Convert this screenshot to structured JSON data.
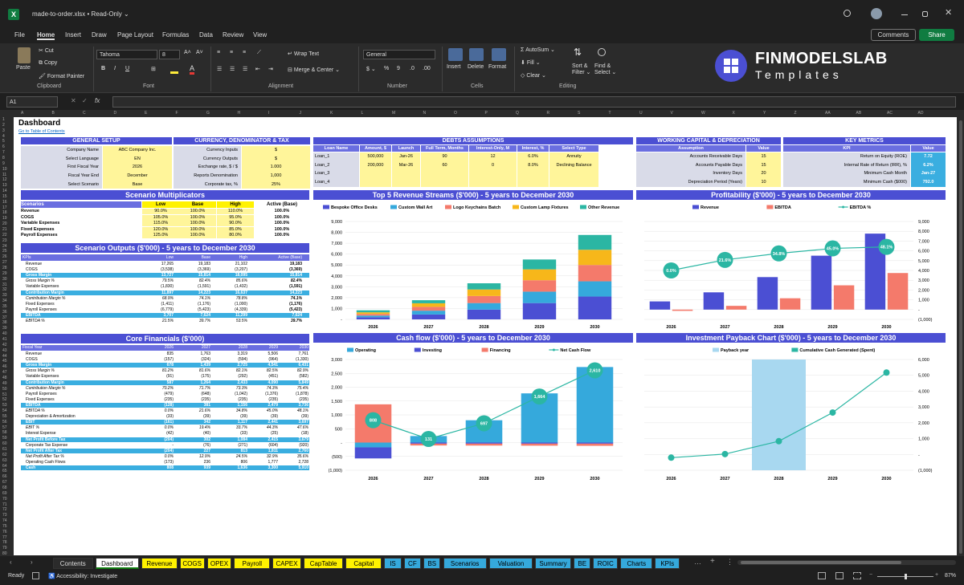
{
  "titlebar": {
    "file": "made-to-order.xlsx",
    "sep": "•",
    "mode": "Read-Only",
    "chev": "⌄"
  },
  "menu": [
    "File",
    "Home",
    "Insert",
    "Draw",
    "Page Layout",
    "Formulas",
    "Data",
    "Review",
    "View"
  ],
  "comments_label": "Comments",
  "share_label": "Share",
  "ribbon": {
    "paste": "Paste",
    "cut": "Cut",
    "copy": "Copy",
    "format_painter": "Format Painter",
    "clipboard": "Clipboard",
    "font_name": "Tahoma",
    "font_size": "8",
    "font_group": "Font",
    "wrap": "Wrap Text",
    "merge": "Merge & Center",
    "alignment": "Alignment",
    "num_format": "General",
    "number": "Number",
    "insert": "Insert",
    "delete": "Delete",
    "format": "Format",
    "cells": "Cells",
    "autosum": "AutoSum",
    "fill": "Fill",
    "clear": "Clear",
    "sort": "Sort &",
    "filter": "Filter",
    "find": "Find &",
    "select": "Select",
    "editing": "Editing",
    "logo_title": "FINMODELSLAB",
    "logo_sub": "Templates"
  },
  "formula": {
    "cellref": "A1",
    "fx": "fx"
  },
  "columns": [
    "A",
    "B",
    "C",
    "D",
    "E",
    "F",
    "G",
    "H",
    "I",
    "J",
    "K",
    "L",
    "M",
    "N",
    "O",
    "P",
    "Q",
    "R",
    "S",
    "T",
    "U",
    "V",
    "W",
    "X",
    "Y",
    "Z",
    "AA",
    "AB",
    "AC",
    "AD"
  ],
  "sheet": {
    "title": "Dashboard",
    "toc": "Go to Table of Contents",
    "general": {
      "header": "GENERAL SETUP",
      "rows": [
        [
          "Company Name",
          "ABC Company Inc."
        ],
        [
          "Select Language",
          "EN"
        ],
        [
          "First Fiscal Year",
          "2026"
        ],
        [
          "Fiscal Year End",
          "December"
        ],
        [
          "Select Scenario",
          "Base"
        ]
      ]
    },
    "currency": {
      "header": "CURRENCY, DENOMINATOR & TAX",
      "rows": [
        [
          "Currency Inputs",
          "$"
        ],
        [
          "Currency Outputs",
          "$"
        ],
        [
          "Exchange rate, $ / $",
          "1.000"
        ],
        [
          "Reports Denomination",
          "1,000"
        ],
        [
          "Corporate tax, %",
          "25%"
        ]
      ]
    },
    "debts": {
      "header": "DEBTS ASSUMPTIONS",
      "cols": [
        "Loan Name",
        "Amount, $",
        "Launch",
        "Full Term, Months",
        "Interest-Only, M",
        "Interest, %",
        "Select Type"
      ],
      "rows": [
        [
          "Loan_1",
          "500,000",
          "Jan-26",
          "90",
          "12",
          "6.0%",
          "Annuity"
        ],
        [
          "Loan_2",
          "200,000",
          "Mar-26",
          "60",
          "0",
          "8.0%",
          "Declining Balance"
        ],
        [
          "Loan_3",
          "",
          "",
          "",
          "",
          "",
          ""
        ],
        [
          "Loan_4",
          "",
          "",
          "",
          "",
          "",
          ""
        ]
      ]
    },
    "wc": {
      "header": "WORKING CAPITAL & DEPRECIATION",
      "cols": [
        "Assumption",
        "Value"
      ],
      "rows": [
        [
          "Accounts Receivable Days",
          "15"
        ],
        [
          "Accounts Payable Days",
          "15"
        ],
        [
          "Inventory Days",
          "20"
        ],
        [
          "Depreciation Period (Years)",
          "10"
        ]
      ]
    },
    "kpi": {
      "header": "KEY METRICS",
      "cols": [
        "KPI",
        "Value"
      ],
      "rows": [
        [
          "Return on Equity (ROE)",
          "7.72"
        ],
        [
          "Internal Rate of Return (IRR), %",
          "6.2%"
        ],
        [
          "Minimum Cash Month",
          "Jan-27"
        ],
        [
          "Minimum Cash ($000)",
          "792.0"
        ]
      ]
    },
    "scen_mult": {
      "header": "Scenario Multiplicators",
      "cols": [
        "Scenarios",
        "Low",
        "Base",
        "High",
        "Active (Base)"
      ],
      "rows": [
        [
          "Revenue",
          "90.0%",
          "100.0%",
          "110.0%",
          "100.0%"
        ],
        [
          "COGS",
          "105.0%",
          "100.0%",
          "95.0%",
          "100.0%"
        ],
        [
          "Variable Expenses",
          "115.0%",
          "100.0%",
          "90.0%",
          "100.0%"
        ],
        [
          "Fixed Expenses",
          "120.0%",
          "100.0%",
          "85.0%",
          "100.0%"
        ],
        [
          "Payroll Expenses",
          "125.0%",
          "100.0%",
          "80.0%",
          "100.0%"
        ]
      ]
    },
    "scen_out": {
      "header": "Scenario Outputs ($'000) - 5 years to December 2030",
      "cols": [
        "KPIs",
        "Low",
        "Base",
        "High",
        "Active (Base)"
      ],
      "rows": [
        {
          "n": "Revenue",
          "v": [
            "17,265",
            "19,183",
            "21,102",
            "19,183"
          ]
        },
        {
          "n": "COGS",
          "v": [
            "(3,538)",
            "(3,369)",
            "(3,207)",
            "(3,369)"
          ]
        },
        {
          "n": "Gross Margin",
          "v": [
            "13,727",
            "15,814",
            "18,095",
            "15,814"
          ],
          "c": "hl"
        },
        {
          "n": "Gross Margin %",
          "v": [
            "79.5%",
            "82.4%",
            "85.6%",
            "82.4%"
          ],
          "c": "it"
        },
        {
          "n": "Variable Expenses",
          "v": [
            "(1,830)",
            "(1,591)",
            "(1,432)",
            "(1,591)"
          ]
        },
        {
          "n": "Contribution Margin",
          "v": [
            "11,897",
            "14,223",
            "16,637",
            "14,223"
          ],
          "c": "hl"
        },
        {
          "n": "Contribution Margin %",
          "v": [
            "68.9%",
            "74.1%",
            "78.8%",
            "74.1%"
          ],
          "c": "it"
        },
        {
          "n": "Fixed Expenses",
          "v": [
            "(1,411)",
            "(1,176)",
            "(1,000)",
            "(1,176)"
          ]
        },
        {
          "n": "Payroll Expenses",
          "v": [
            "(6,779)",
            "(5,423)",
            "(4,339)",
            "(5,423)"
          ]
        },
        {
          "n": "EBITDA",
          "v": [
            "3,707",
            "7,624",
            "11,299",
            "7,624"
          ],
          "c": "hl"
        },
        {
          "n": "EBITDA %",
          "v": [
            "21.5%",
            "39.7%",
            "53.5%",
            "39.7%"
          ],
          "c": "it"
        }
      ]
    },
    "core": {
      "header": "Core Financials ($'000)",
      "cols": [
        "Fiscal Year",
        "2026",
        "2027",
        "2028",
        "2029",
        "2030"
      ],
      "rows": [
        {
          "n": "Revenue",
          "v": [
            "835",
            "1,763",
            "3,319",
            "5,506",
            "7,761"
          ]
        },
        {
          "n": "COGS",
          "v": [
            "(157)",
            "(324)",
            "(594)",
            "(964)",
            "(1,330)"
          ]
        },
        {
          "n": "Gross Margin",
          "v": [
            "678",
            "1,439",
            "2,725",
            "4,541",
            "6,431"
          ],
          "c": "hl"
        },
        {
          "n": "Gross Margin %",
          "v": [
            "81.2%",
            "81.6%",
            "82.1%",
            "82.5%",
            "82.9%"
          ],
          "c": "it"
        },
        {
          "n": "Variable Expenses",
          "v": [
            "(91)",
            "(175)",
            "(292)",
            "(451)",
            "(582)"
          ]
        },
        {
          "n": "Contribution Margin",
          "v": [
            "587",
            "1,264",
            "2,433",
            "4,090",
            "5,849"
          ],
          "c": "hl"
        },
        {
          "n": "Contribution Margin %",
          "v": [
            "70.2%",
            "71.7%",
            "73.3%",
            "74.3%",
            "75.4%"
          ],
          "c": "it"
        },
        {
          "n": "Payroll Expenses",
          "v": [
            "(479)",
            "(648)",
            "(1,042)",
            "(1,376)",
            "(1,878)"
          ]
        },
        {
          "n": "Fixed Expenses",
          "v": [
            "(235)",
            "(235)",
            "(235)",
            "(235)",
            "(235)"
          ]
        },
        {
          "n": "EBITDA",
          "v": [
            "(128)",
            "381",
            "1,156",
            "2,479",
            "3,736"
          ],
          "c": "hl"
        },
        {
          "n": "EBITDA %",
          "v": [
            "0.0%",
            "21.6%",
            "34.8%",
            "45.0%",
            "48.1%"
          ],
          "c": "it"
        },
        {
          "n": "Depreciation & Amortization",
          "v": [
            "(33)",
            "(39)",
            "(39)",
            "(39)",
            "(39)"
          ]
        },
        {
          "n": "EBIT",
          "v": [
            "(161)",
            "342",
            "1,117",
            "2,441",
            "3,697"
          ],
          "c": "hl"
        },
        {
          "n": "EBIT %",
          "v": [
            "0.0%",
            "19.4%",
            "33.7%",
            "44.3%",
            "47.6%"
          ],
          "c": "it"
        },
        {
          "n": "Interest Expense",
          "v": [
            "(42)",
            "(40)",
            "(33)",
            "(25)",
            "(18)"
          ]
        },
        {
          "n": "Net Profit Before Tax",
          "v": [
            "(204)",
            "302",
            "1,084",
            "2,415",
            "3,679"
          ],
          "c": "hl"
        },
        {
          "n": "Corporate Tax Expense",
          "v": [
            "-",
            "(76)",
            "(271)",
            "(604)",
            "(920)"
          ]
        },
        {
          "n": "Net Profit After Tax",
          "v": [
            "(204)",
            "227",
            "813",
            "1,811",
            "2,760"
          ],
          "c": "hl"
        },
        {
          "n": "Net Profit After Tax %",
          "v": [
            "0.0%",
            "12.9%",
            "24.5%",
            "32.9%",
            "35.6%"
          ],
          "c": "it"
        },
        {
          "n": "Operating Cash Flows",
          "v": [
            "(173)",
            "236",
            "806",
            "1,777",
            "2,728"
          ]
        },
        {
          "n": "Cash",
          "v": [
            "808",
            "939",
            "1,636",
            "3,300",
            "5,910"
          ],
          "c": "hl"
        }
      ]
    },
    "chart_titles": {
      "rev": "Top 5 Revenue Streams ($'000) - 5 years to December 2030",
      "prof": "Profitability ($'000) - 5 years to December 2030",
      "cash": "Cash flow ($'000) - 5 years to December 2030",
      "pay": "Investment Payback Chart ($'000) - 5 years to December 2030"
    }
  },
  "chart_data": [
    {
      "type": "bar",
      "stacked": true,
      "title": "Top 5 Revenue Streams ($'000) - 5 years to December 2030",
      "categories": [
        "2026",
        "2027",
        "2028",
        "2029",
        "2030"
      ],
      "ylim": [
        0,
        9000
      ],
      "series": [
        {
          "name": "Bespoke Office Desks",
          "color": "#4b4fd3",
          "values": [
            200,
            450,
            900,
            1500,
            2100
          ]
        },
        {
          "name": "Custom Wall Art",
          "color": "#35a9dc",
          "values": [
            150,
            350,
            600,
            1050,
            1400
          ]
        },
        {
          "name": "Logo Keychains Batch",
          "color": "#f47a6b",
          "values": [
            150,
            350,
            650,
            1050,
            1500
          ]
        },
        {
          "name": "Custom Lamp Fixtures",
          "color": "#f7b71a",
          "values": [
            150,
            330,
            600,
            1000,
            1400
          ]
        },
        {
          "name": "Other Revenue",
          "color": "#2bb6a3",
          "values": [
            185,
            283,
            569,
            906,
            1361
          ]
        }
      ]
    },
    {
      "type": "bar",
      "title": "Profitability ($'000) - 5 years to December 2030",
      "categories": [
        "2026",
        "2027",
        "2028",
        "2029",
        "2030"
      ],
      "ylim": [
        -1000,
        9000
      ],
      "y2lim": [
        -100,
        100
      ],
      "series": [
        {
          "name": "Revenue",
          "color": "#4b4fd3",
          "values": [
            835,
            1763,
            3319,
            5506,
            7761
          ]
        },
        {
          "name": "EBITDA",
          "color": "#f47a6b",
          "values": [
            -128,
            381,
            1156,
            2479,
            3736
          ]
        },
        {
          "name": "EBITDA %",
          "type": "line",
          "color": "#2bb6a3",
          "values": [
            0.0,
            21.6,
            34.8,
            45.0,
            48.1
          ],
          "labels": [
            "0.0%",
            "21.6%",
            "34.8%",
            "45.0%",
            "48.1%"
          ]
        }
      ]
    },
    {
      "type": "bar",
      "stacked": true,
      "title": "Cash flow ($'000) - 5 years to December 2030",
      "categories": [
        "2026",
        "2027",
        "2028",
        "2029",
        "2030"
      ],
      "ylim": [
        -1000,
        3000
      ],
      "series": [
        {
          "name": "Operating",
          "color": "#35a9dc",
          "values": [
            -173,
            236,
            806,
            1777,
            2728
          ]
        },
        {
          "name": "Investing",
          "color": "#4b4fd3",
          "values": [
            -400,
            -40,
            -40,
            -40,
            -40
          ]
        },
        {
          "name": "Financing",
          "color": "#f47a6b",
          "values": [
            1381,
            -65,
            -69,
            -73,
            -78
          ]
        },
        {
          "name": "Net Cash Flow",
          "type": "line",
          "color": "#2bb6a3",
          "values": [
            808,
            131,
            697,
            1664,
            2610
          ],
          "labels": [
            "808",
            "131",
            "697",
            "1,664",
            "2,610"
          ]
        }
      ]
    },
    {
      "type": "line",
      "title": "Investment Payback Chart ($'000) - 5 years to December 2030",
      "categories": [
        "2026",
        "2027",
        "2028",
        "2029",
        "2030"
      ],
      "ylim": [
        -1000,
        6000
      ],
      "series": [
        {
          "name": "Payback year",
          "type": "bar",
          "color": "#a8d8f0",
          "values": [
            0,
            0,
            1,
            0,
            0
          ]
        },
        {
          "name": "Cumulative Cash Generated (Spent)",
          "color": "#2bb6a3",
          "values": [
            -204,
            23,
            836,
            2647,
            5175
          ]
        }
      ]
    }
  ],
  "sheet_tabs": [
    {
      "l": "Contents",
      "c": "t-w"
    },
    {
      "l": "Dashboard",
      "c": "t-a"
    },
    {
      "l": "Revenue",
      "c": "t-y"
    },
    {
      "l": "COGS",
      "c": "t-y"
    },
    {
      "l": "OPEX",
      "c": "t-y"
    },
    {
      "l": "Payroll",
      "c": "t-y"
    },
    {
      "l": "CAPEX",
      "c": "t-y"
    },
    {
      "l": "CapTable",
      "c": "t-y"
    },
    {
      "l": "Capital",
      "c": "t-y"
    },
    {
      "l": "IS",
      "c": "t-b"
    },
    {
      "l": "CF",
      "c": "t-b"
    },
    {
      "l": "BS",
      "c": "t-b"
    },
    {
      "l": "Scenarios",
      "c": "t-b"
    },
    {
      "l": "Valuation",
      "c": "t-b"
    },
    {
      "l": "Summary",
      "c": "t-b"
    },
    {
      "l": "BE",
      "c": "t-b"
    },
    {
      "l": "ROIC",
      "c": "t-b"
    },
    {
      "l": "Charts",
      "c": "t-b"
    },
    {
      "l": "KPIs",
      "c": "t-b"
    }
  ],
  "status": {
    "ready": "Ready",
    "access": "Accessibility: Investigate",
    "zoom": "87%"
  }
}
